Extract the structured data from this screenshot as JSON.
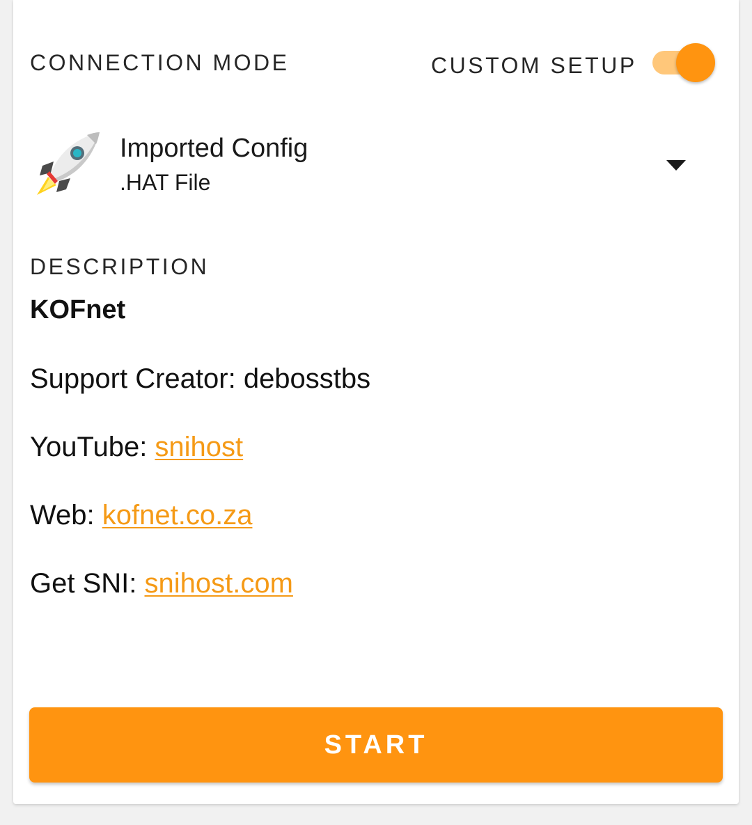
{
  "header": {
    "connection_mode_label": "CONNECTION MODE",
    "custom_setup_label": "CUSTOM SETUP",
    "custom_setup_enabled": true
  },
  "config": {
    "title": "Imported Config",
    "subtitle": ".HAT File",
    "icon": "rocket-icon"
  },
  "description": {
    "label": "DESCRIPTION",
    "name": "KOFnet",
    "support_line": "Support Creator: debosstbs",
    "youtube_prefix": "YouTube: ",
    "youtube_link": "snihost",
    "web_prefix": "Web: ",
    "web_link": "kofnet.co.za",
    "sni_prefix": "Get SNI: ",
    "sni_link": "snihost.com"
  },
  "actions": {
    "start_label": "START"
  },
  "colors": {
    "accent": "#ff9410",
    "toggle_track": "#ffc77a",
    "link": "#f59a16"
  }
}
